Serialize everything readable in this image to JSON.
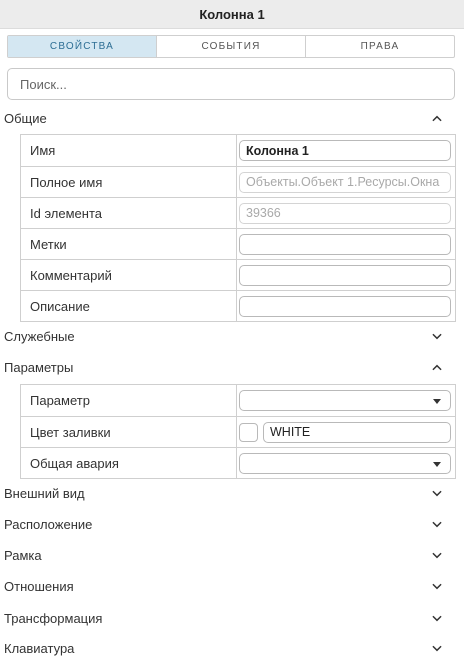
{
  "window": {
    "title": "Колонна 1"
  },
  "tabs": [
    {
      "label": "СВОЙСТВА",
      "active": true
    },
    {
      "label": "СОБЫТИЯ",
      "active": false
    },
    {
      "label": "ПРАВА",
      "active": false
    }
  ],
  "search": {
    "placeholder": "Поиск..."
  },
  "sections": {
    "general": {
      "label": "Общие",
      "state": "expanded",
      "rows": {
        "name": {
          "label": "Имя",
          "value": "Колонна 1"
        },
        "full_name": {
          "label": "Полное имя",
          "value": "Объекты.Объект 1.Ресурсы.Окна"
        },
        "element_id": {
          "label": "Id элемента",
          "value": "39366"
        },
        "tags": {
          "label": "Метки",
          "value": ""
        },
        "comment": {
          "label": "Комментарий",
          "value": ""
        },
        "description": {
          "label": "Описание",
          "value": ""
        }
      }
    },
    "service": {
      "label": "Служебные",
      "state": "collapsed"
    },
    "parameters": {
      "label": "Параметры",
      "state": "expanded",
      "rows": {
        "parameter": {
          "label": "Параметр",
          "value": ""
        },
        "fill_color": {
          "label": "Цвет заливки",
          "value": "WHITE",
          "swatch": "#ffffff"
        },
        "general_alarm": {
          "label": "Общая авария",
          "value": ""
        }
      }
    },
    "appearance": {
      "label": "Внешний вид",
      "state": "collapsed"
    },
    "placement": {
      "label": "Расположение",
      "state": "collapsed"
    },
    "frame": {
      "label": "Рамка",
      "state": "collapsed"
    },
    "relations": {
      "label": "Отношения",
      "state": "collapsed"
    },
    "transform": {
      "label": "Трансформация",
      "state": "collapsed"
    },
    "keyboard": {
      "label": "Клавиатура",
      "state": "collapsed"
    }
  },
  "colors": {
    "active_tab_bg": "#d4e7f2",
    "active_tab_text": "#2d6e94",
    "title_bar_bg": "#ececec"
  },
  "icons": {
    "expanded": "chevron-up-icon",
    "collapsed": "chevron-down-icon",
    "dropdown": "caret-down-icon"
  }
}
